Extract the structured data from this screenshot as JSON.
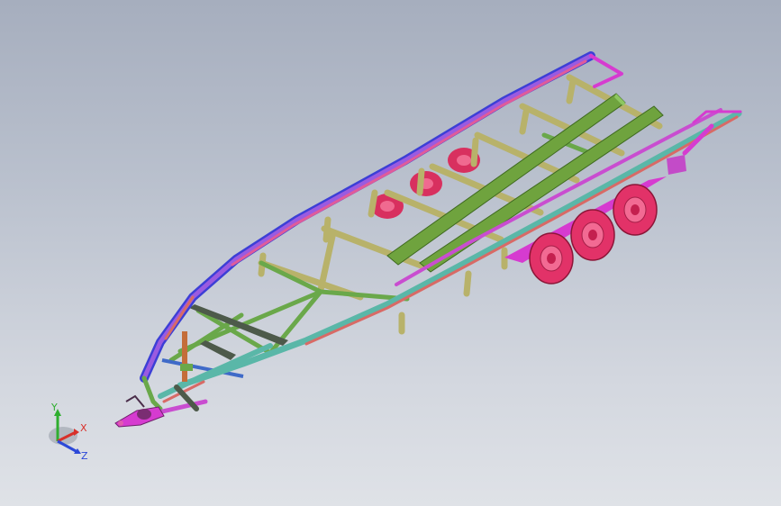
{
  "viewport": {
    "background_top": "#a6aebe",
    "background_bottom": "#dfe2e7"
  },
  "model": {
    "description_colors": {
      "green": "#5f9a37",
      "olive": "#b9b46a",
      "magenta": "#d63bd0",
      "purple": "#7a4fd8",
      "blue": "#3c3fd6",
      "salmon": "#d86a66",
      "teal": "#5ab7a8",
      "tire": "#e23268"
    }
  },
  "triad": {
    "y_label": "Y",
    "x_label": "X",
    "z_label": "Z",
    "y_color": "#2fae2f",
    "x_color": "#d8302a",
    "z_color": "#2c49d8"
  }
}
